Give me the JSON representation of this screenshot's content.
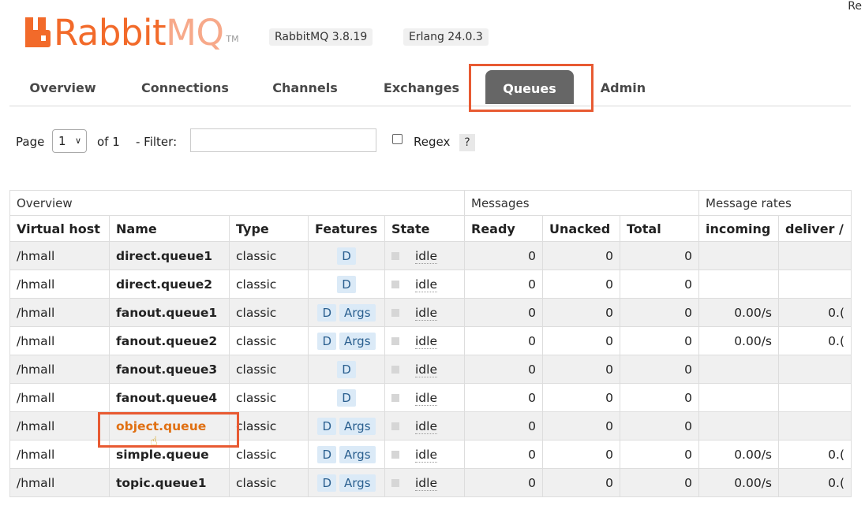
{
  "header": {
    "logo_primary": "Rabbit",
    "logo_secondary": "MQ",
    "logo_tm": "TM",
    "version_badge": "RabbitMQ 3.8.19",
    "erlang_badge": "Erlang 24.0.3",
    "top_right_text": "Re"
  },
  "tabs": [
    {
      "label": "Overview"
    },
    {
      "label": "Connections"
    },
    {
      "label": "Channels"
    },
    {
      "label": "Exchanges"
    },
    {
      "label": "Queues"
    },
    {
      "label": "Admin"
    }
  ],
  "active_tab": "Queues",
  "filter": {
    "page_label": "Page",
    "page_value": "1",
    "of_label": "of 1",
    "filter_label": "- Filter:",
    "filter_value": "",
    "regex_label": "Regex",
    "help": "?"
  },
  "table": {
    "groups": [
      "Overview",
      "Messages",
      "Message rates"
    ],
    "columns": [
      "Virtual host",
      "Name",
      "Type",
      "Features",
      "State",
      "Ready",
      "Unacked",
      "Total",
      "incoming",
      "deliver /"
    ],
    "rows": [
      {
        "vhost": "/hmall",
        "name": "direct.queue1",
        "type": "classic",
        "features": [
          "D"
        ],
        "state": "idle",
        "ready": "0",
        "unacked": "0",
        "total": "0",
        "incoming": "",
        "deliver": ""
      },
      {
        "vhost": "/hmall",
        "name": "direct.queue2",
        "type": "classic",
        "features": [
          "D"
        ],
        "state": "idle",
        "ready": "0",
        "unacked": "0",
        "total": "0",
        "incoming": "",
        "deliver": ""
      },
      {
        "vhost": "/hmall",
        "name": "fanout.queue1",
        "type": "classic",
        "features": [
          "D",
          "Args"
        ],
        "state": "idle",
        "ready": "0",
        "unacked": "0",
        "total": "0",
        "incoming": "0.00/s",
        "deliver": "0.("
      },
      {
        "vhost": "/hmall",
        "name": "fanout.queue2",
        "type": "classic",
        "features": [
          "D",
          "Args"
        ],
        "state": "idle",
        "ready": "0",
        "unacked": "0",
        "total": "0",
        "incoming": "0.00/s",
        "deliver": "0.("
      },
      {
        "vhost": "/hmall",
        "name": "fanout.queue3",
        "type": "classic",
        "features": [
          "D"
        ],
        "state": "idle",
        "ready": "0",
        "unacked": "0",
        "total": "0",
        "incoming": "",
        "deliver": ""
      },
      {
        "vhost": "/hmall",
        "name": "fanout.queue4",
        "type": "classic",
        "features": [
          "D"
        ],
        "state": "idle",
        "ready": "0",
        "unacked": "0",
        "total": "0",
        "incoming": "",
        "deliver": ""
      },
      {
        "vhost": "/hmall",
        "name": "object.queue",
        "type": "classic",
        "features": [
          "D",
          "Args"
        ],
        "state": "idle",
        "ready": "0",
        "unacked": "0",
        "total": "0",
        "incoming": "",
        "deliver": ""
      },
      {
        "vhost": "/hmall",
        "name": "simple.queue",
        "type": "classic",
        "features": [
          "D",
          "Args"
        ],
        "state": "idle",
        "ready": "0",
        "unacked": "0",
        "total": "0",
        "incoming": "0.00/s",
        "deliver": "0.("
      },
      {
        "vhost": "/hmall",
        "name": "topic.queue1",
        "type": "classic",
        "features": [
          "D",
          "Args"
        ],
        "state": "idle",
        "ready": "0",
        "unacked": "0",
        "total": "0",
        "incoming": "0.00/s",
        "deliver": "0.("
      }
    ],
    "highlighted_row_name": "object.queue"
  },
  "colors": {
    "brand_orange": "#f26a2a",
    "highlight_box": "#e85a32",
    "active_tab_bg": "#666666",
    "chip_bg": "#dbeaf7",
    "link_orange": "#e07012"
  },
  "icons": [
    "rabbitmq-logo-icon",
    "chevron-down-icon",
    "checkbox-icon",
    "hand-cursor-icon"
  ]
}
